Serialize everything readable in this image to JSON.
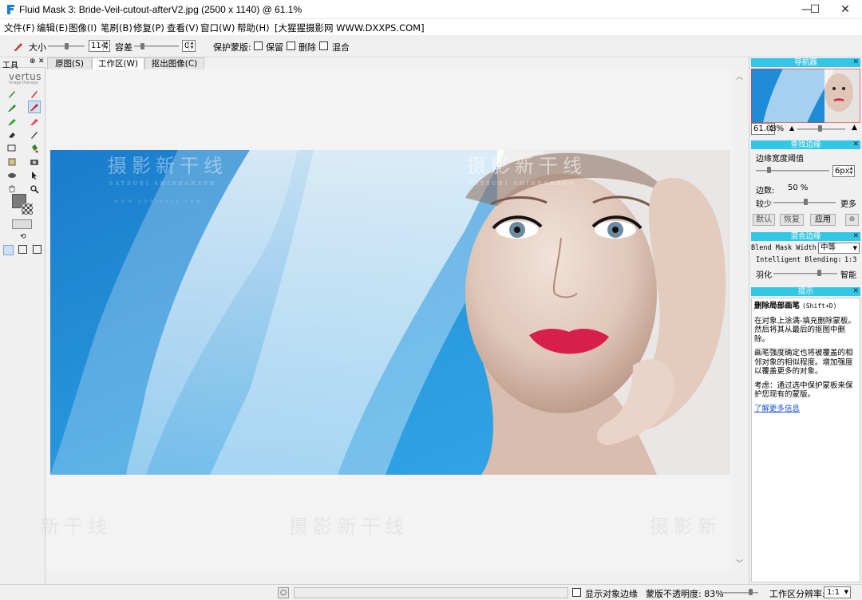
{
  "window": {
    "title": "Fluid Mask 3: Bride-Veil-cutout-afterV2.jpg (2500 x 1140) @ 61.1%",
    "controls": {
      "minimize": "—",
      "maximize": "☐",
      "close": "✕"
    }
  },
  "menu": [
    "文件(F)",
    "编辑(E)",
    "图像(I)",
    "笔刷(B)",
    "修复(P)",
    "查看(V)",
    "窗口(W)",
    "帮助(H)",
    "[大猩猩摄影网 WWW.DXXPS.COM]"
  ],
  "toolbar": {
    "size_label": "大小",
    "size_value": "114",
    "tolerance_label": "容差",
    "tolerance_value": "0",
    "protect_label": "保护蒙版:",
    "keep_label": "保留",
    "delete_label": "删除",
    "blend_label": "混合"
  },
  "tool_panel": {
    "title": "工具",
    "logo_main": "vertus",
    "logo_sub": "image therapy"
  },
  "tabs": [
    {
      "label": "原图(S)"
    },
    {
      "label": "工作区(W)",
      "active": true
    },
    {
      "label": "抠出图像(C)"
    }
  ],
  "watermark": {
    "main": "摄影新干线",
    "sub": "SATSUEI SHINKANSEN",
    "url": "www.photosns.com",
    "bottom_left": "新干线",
    "bottom_center": "摄影新干线",
    "bottom_right": "摄影新"
  },
  "navigator": {
    "title": "导航器",
    "zoom_value": "61.08%"
  },
  "find_edges": {
    "title": "查找边缘",
    "threshold_label": "边缘宽度阈值",
    "threshold_value": "6px",
    "edges_label": "边数:",
    "edges_value": "50 %",
    "less_label": "较少",
    "more_label": "更多",
    "default_button": "默认",
    "restore_button": "恢复",
    "apply_button": "应用"
  },
  "blend_edges": {
    "title": "混合边缘",
    "mask_width_label": "Blend Mask Width:",
    "mask_width_value": "中等",
    "intelligent_label": "Intelligent Blending:",
    "intelligent_value": "1:3",
    "feather_label": "羽化",
    "smart_label": "智能"
  },
  "hint": {
    "title": "提示",
    "heading": "删除局部画笔",
    "shortcut": "(Shift+D)",
    "p1": "在对象上涂满-填充删除蒙板。然后将其从最后的抠图中删除。",
    "p2": "画笔强度确定也将被覆盖的相邻对象的相似程度。增加强度以覆盖更多的对象。",
    "p3": "考虑：通过选中保护蒙板来保护您现有的蒙版。",
    "link": "了解更多信息"
  },
  "status": {
    "show_edges_label": "显示对象边缘",
    "opacity_label": "蒙版不透明度: 83%",
    "resolution_label": "工作区分辨率:",
    "resolution_value": "1:1"
  },
  "colors": {
    "panel_header": "#33c7e6",
    "photo_bg": "#1b86cf",
    "selected_tool": "#cfe0f4"
  }
}
